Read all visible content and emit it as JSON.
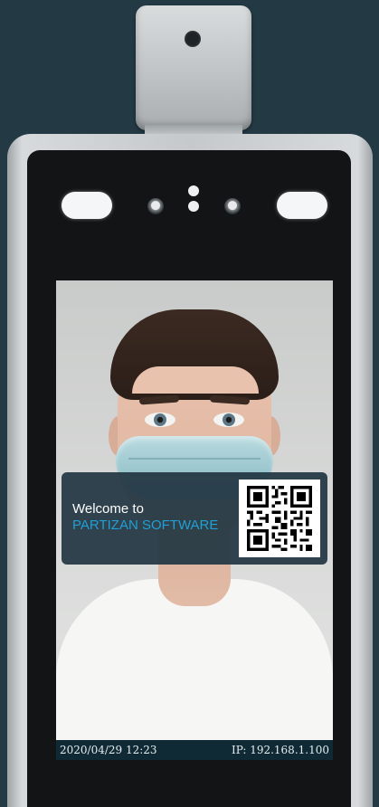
{
  "welcome_card": {
    "line1": "Welcome to",
    "line2": "PARTIZAN SOFTWARE"
  },
  "status_bar": {
    "datetime": "2020/04/29  12:23",
    "ip": "IP: 192.168.1.100"
  },
  "colors": {
    "background": "#233a45",
    "card": "#243844",
    "accent": "#1fa0d6",
    "status_bar": "#0f2a35"
  },
  "icons": {
    "qr": "qr-code-icon"
  }
}
